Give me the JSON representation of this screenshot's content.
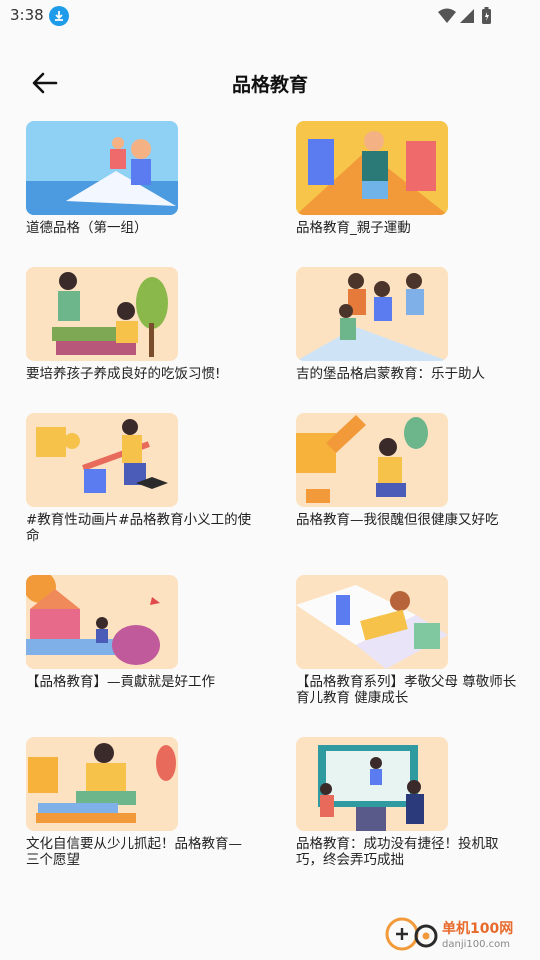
{
  "status": {
    "time": "3:38"
  },
  "header": {
    "title": "品格教育"
  },
  "items": [
    {
      "caption": "道德品格（第一组）"
    },
    {
      "caption": "品格教育_親子運動"
    },
    {
      "caption": "要培养孩子养成良好的吃饭习惯!"
    },
    {
      "caption": "吉的堡品格启蒙教育：乐于助人"
    },
    {
      "caption": "#教育性动画片#品格教育小义工的使命"
    },
    {
      "caption": "品格教育—我很醜但很健康又好吃"
    },
    {
      "caption": "【品格教育】—貢獻就是好工作"
    },
    {
      "caption": "【品格教育系列】孝敬父母 尊敬师长 育儿教育 健康成长"
    },
    {
      "caption": "文化自信要从少儿抓起！品格教育—三个愿望"
    },
    {
      "caption": "品格教育：成功没有捷径！投机取巧，终会弄巧成拙"
    }
  ],
  "watermark": {
    "brand": "单机100网",
    "url": "danji100.com"
  },
  "colors": {
    "accent": "#1e9be9",
    "thumb_bg": "#fde2c2"
  }
}
